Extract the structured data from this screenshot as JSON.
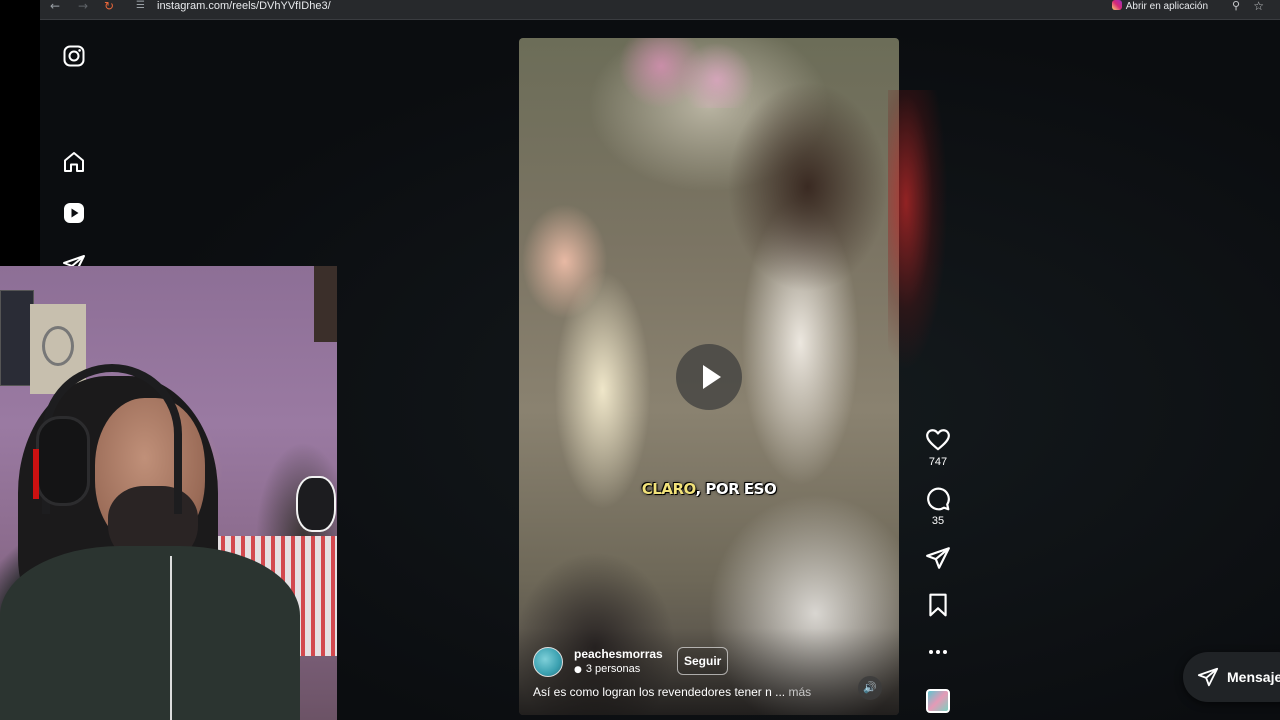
{
  "browser": {
    "url": "instagram.com/reels/DVhYVfIDhe3/",
    "open_in_app_label": "Abrir en aplicación",
    "nav_icons": [
      "back-icon",
      "forward-icon",
      "reload-icon",
      "site-info-icon",
      "zoom-icon",
      "bookmark-star-icon"
    ]
  },
  "sidebar": {
    "items": [
      {
        "icon": "instagram-logo-icon"
      },
      {
        "icon": "home-icon"
      },
      {
        "icon": "reels-icon"
      },
      {
        "icon": "direct-messages-icon"
      }
    ]
  },
  "reel": {
    "caption_overlay": {
      "highlight": "CLARO",
      "rest": ", POR ESO"
    },
    "author": "peachesmorras",
    "collaborators": "3 personas",
    "follow_label": "Seguir",
    "description": "Así es como logran los revendedores tener n ...",
    "more_label": "más",
    "play_icon": "play-icon",
    "audio_icon": "speaker-icon"
  },
  "actions": {
    "likes": "747",
    "comments": "35",
    "icons": [
      "heart-icon",
      "comment-icon",
      "share-icon",
      "bookmark-icon",
      "more-icon"
    ]
  },
  "messages": {
    "label": "Mensajes"
  },
  "colors": {
    "page_bg": "#0b0d10",
    "browser_bar": "#27292c",
    "accent_caption": "#f2e27a"
  }
}
